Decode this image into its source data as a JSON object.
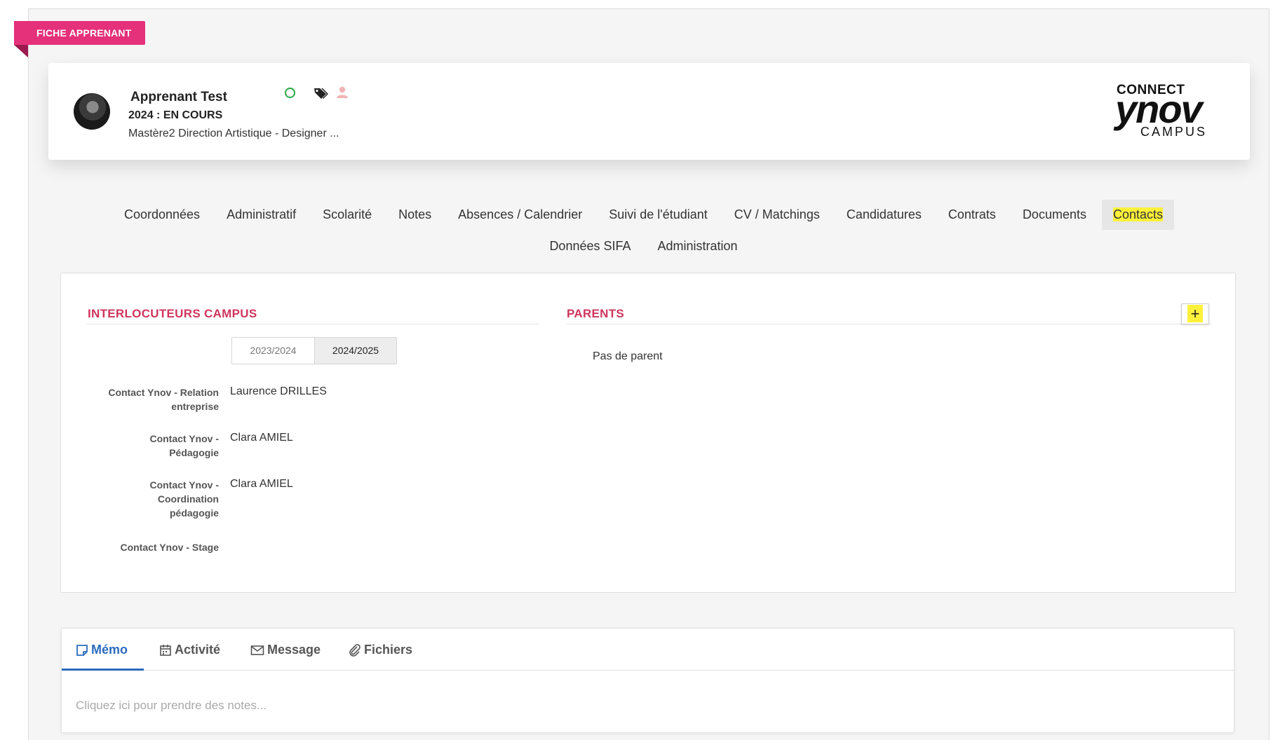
{
  "ribbon": {
    "label": "FICHE APPRENANT"
  },
  "learner": {
    "name": "Apprenant Test",
    "status": "2024 : EN COURS",
    "program": "Mastère2 Direction Artistique - Designer ..."
  },
  "status_icons": [
    "circle-icon",
    "tags-icon",
    "user-icon"
  ],
  "logo": {
    "line1": "CONNECT",
    "line2": "ynov",
    "line3": "CAMPUS"
  },
  "nav": {
    "row1": [
      "Coordonnées",
      "Administratif",
      "Scolarité",
      "Notes",
      "Absences / Calendrier",
      "Suivi de l'étudiant",
      "CV / Matchings",
      "Candidatures",
      "Contrats",
      "Documents",
      "Contacts"
    ],
    "row2": [
      "Données SIFA",
      "Administration"
    ],
    "active": "Contacts"
  },
  "interlocuteurs": {
    "title": "INTERLOCUTEURS CAMPUS",
    "years": [
      "2023/2024",
      "2024/2025"
    ],
    "active_year": "2024/2025",
    "contacts": [
      {
        "label": "Contact Ynov - Relation entreprise",
        "value": "Laurence DRILLES"
      },
      {
        "label": "Contact Ynov - Pédagogie",
        "value": "Clara AMIEL"
      },
      {
        "label": "Contact Ynov - Coordination pédagogie",
        "value": "Clara AMIEL"
      },
      {
        "label": "Contact Ynov - Stage",
        "value": ""
      }
    ]
  },
  "parents": {
    "title": "PARENTS",
    "add_label": "+",
    "empty_text": "Pas de parent"
  },
  "memo": {
    "tabs": [
      "Mémo",
      "Activité",
      "Message",
      "Fichiers"
    ],
    "active_tab": "Mémo",
    "placeholder": "Cliquez ici pour prendre des notes..."
  },
  "colors": {
    "ribbon": "#e5307a",
    "section_title": "#d0355d",
    "active_tab_blue": "#2c6bbf",
    "highlight": "#fff13a",
    "status_green": "#28a745"
  }
}
